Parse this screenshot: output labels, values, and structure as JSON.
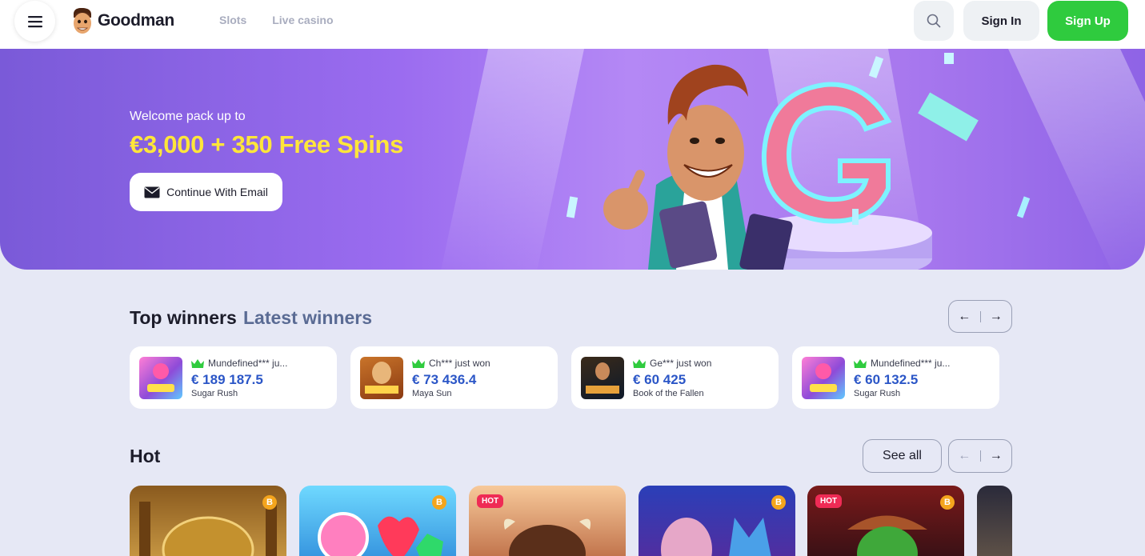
{
  "header": {
    "brand": "Goodman",
    "nav": [
      "Slots",
      "Live casino"
    ],
    "sign_in": "Sign In",
    "sign_up": "Sign Up"
  },
  "hero": {
    "subtitle": "Welcome pack up to",
    "title": "€3,000 + 350 Free Spins",
    "cta": "Continue With Email"
  },
  "winners": {
    "title": "Top winners",
    "alt_title": "Latest winners",
    "items": [
      {
        "name": "Mundefined*** ju...",
        "amount": "€ 189 187.5",
        "game": "Sugar Rush",
        "thumb": "sugar"
      },
      {
        "name": "Ch*** just won",
        "amount": "€ 73 436.4",
        "game": "Maya Sun",
        "thumb": "maya"
      },
      {
        "name": "Ge*** just won",
        "amount": "€ 60 425",
        "game": "Book of the Fallen",
        "thumb": "book"
      },
      {
        "name": "Mundefined*** ju...",
        "amount": "€ 60 132.5",
        "game": "Sugar Rush",
        "thumb": "sugar"
      }
    ]
  },
  "hot": {
    "title": "Hot",
    "see_all": "See all",
    "tiles": [
      {
        "badge_hot": "",
        "btc": "B",
        "colors": [
          "#8a5a1e",
          "#d3a34a"
        ]
      },
      {
        "badge_hot": "",
        "btc": "B",
        "colors": [
          "#4fc7f0",
          "#2a86d8"
        ]
      },
      {
        "badge_hot": "HOT",
        "btc": "",
        "colors": [
          "#f0b87c",
          "#b5603a"
        ]
      },
      {
        "badge_hot": "",
        "btc": "B",
        "colors": [
          "#2a3fb8",
          "#5a2a9a"
        ]
      },
      {
        "badge_hot": "HOT",
        "btc": "B",
        "colors": [
          "#7a1a1a",
          "#2a0e14"
        ]
      }
    ]
  },
  "arrows": {
    "prev": "←",
    "next": "→"
  }
}
